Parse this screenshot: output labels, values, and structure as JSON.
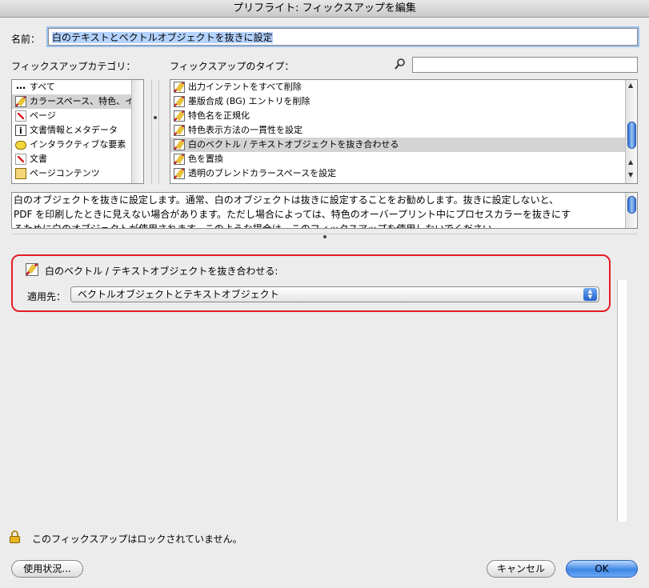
{
  "window": {
    "title": "プリフライト: フィックスアップを編集"
  },
  "name_field": {
    "label": "名前：",
    "value": "白のテキストとベクトルオブジェクトを抜きに設定"
  },
  "categories": {
    "label": "フィックスアップカテゴリ：",
    "items": [
      {
        "label": "すべて",
        "icon": "ellipsis-icon"
      },
      {
        "label": "カラースペース、特色、イ",
        "icon": "fixup-icon",
        "selected": true
      },
      {
        "label": "ページ",
        "icon": "pdf-icon"
      },
      {
        "label": "文書情報とメタデータ",
        "icon": "info-icon"
      },
      {
        "label": "インタラクティブな要素",
        "icon": "bubble-icon"
      },
      {
        "label": "文書",
        "icon": "pdf-icon"
      },
      {
        "label": "ページコンテンツ",
        "icon": "content-icon"
      }
    ]
  },
  "types": {
    "label": "フィックスアップのタイプ：",
    "items": [
      {
        "label": "出力インテントをすべて削除"
      },
      {
        "label": "墨版合成 (BG) エントリを削除"
      },
      {
        "label": "特色名を正規化"
      },
      {
        "label": "特色表示方法の一貫性を設定"
      },
      {
        "label": "白のベクトル / テキストオブジェクトを抜き合わせる",
        "selected": true
      },
      {
        "label": "色を置換"
      },
      {
        "label": "透明のブレンドカラースペースを設定"
      }
    ]
  },
  "search": {
    "value": ""
  },
  "description": {
    "line1": "白のオブジェクトを抜きに設定します。通常、白のオブジェクトは抜きに設定することをお勧めします。抜きに設定しないと、",
    "line2": "PDF を印刷したときに見えない場合があります。ただし場合によっては、特色のオーバープリント中にプロセスカラーを抜きにす",
    "line3": "るために白のオブジェクトが使用されます。このような場合は、このフィックスアップを使用しないでください。"
  },
  "detail": {
    "title": "白のベクトル / テキストオブジェクトを抜き合わせる:",
    "apply_label": "適用先：",
    "apply_value": "ベクトルオブジェクトとテキストオブジェクト"
  },
  "lock_status": "このフィックスアップはロックされていません。",
  "buttons": {
    "usage": "使用状況...",
    "cancel": "キャンセル",
    "ok": "OK"
  }
}
